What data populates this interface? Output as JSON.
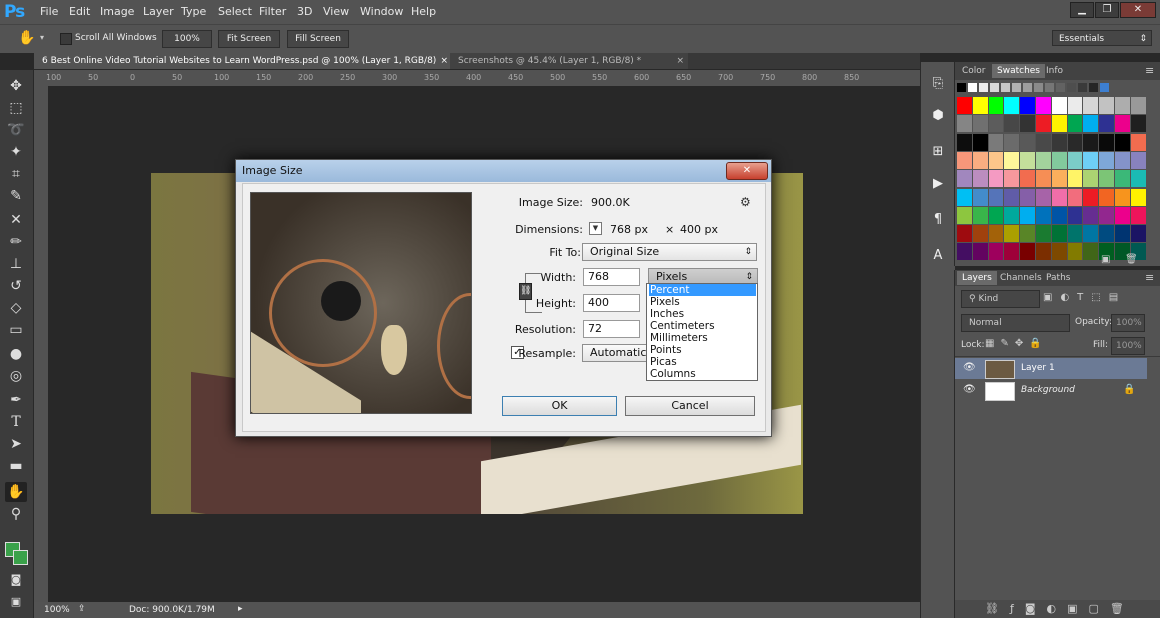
{
  "app": {
    "logo": "Ps"
  },
  "menu": [
    "File",
    "Edit",
    "Image",
    "Layer",
    "Type",
    "Select",
    "Filter",
    "3D",
    "View",
    "Window",
    "Help"
  ],
  "window_buttons": [
    "▁",
    "❐",
    "✕"
  ],
  "options": {
    "scroll_all_label": "Scroll All Windows",
    "btn_100": "100%",
    "btn_fit": "Fit Screen",
    "btn_fill": "Fill Screen",
    "workspace": "Essentials"
  },
  "tabs": [
    {
      "label": "6 Best Online Video Tutorial Websites to Learn WordPress.psd @ 100% (Layer 1, RGB/8)",
      "close": "×"
    },
    {
      "label": "Screenshots @ 45.4% (Layer 1, RGB/8) *",
      "close": "×"
    }
  ],
  "ruler": [
    "100",
    "50",
    "0",
    "50",
    "100",
    "150",
    "200",
    "250",
    "300",
    "350",
    "400",
    "450",
    "500",
    "550",
    "600",
    "650",
    "700",
    "750",
    "800",
    "850"
  ],
  "status": {
    "zoom": "100%",
    "doc": "Doc: 900.0K/1.79M"
  },
  "dialog": {
    "title": "Image Size",
    "close": "✕",
    "image_size_label": "Image Size:",
    "image_size_value": "900.0K",
    "dimensions_label": "Dimensions:",
    "dimensions_w": "768 px",
    "dimensions_x": "×",
    "dimensions_h": "400 px",
    "fit_label": "Fit To:",
    "fit_value": "Original Size",
    "width_label": "Width:",
    "width_value": "768",
    "height_label": "Height:",
    "height_value": "400",
    "resolution_label": "Resolution:",
    "resolution_value": "72",
    "resample_label": "Resample:",
    "resample_value": "Automatic",
    "unit_value": "Pixels",
    "unit_options": [
      "Percent",
      "Pixels",
      "Inches",
      "Centimeters",
      "Millimeters",
      "Points",
      "Picas",
      "Columns"
    ],
    "unit_highlighted": "Percent",
    "ok": "OK",
    "cancel": "Cancel"
  },
  "swatch_tabs": [
    "Color",
    "Swatches",
    "Info"
  ],
  "swatch_colors": [
    [
      "#000000",
      "#ffffff",
      "#ededed",
      "#d9d9d9",
      "#c6c6c6",
      "#b2b2b2",
      "#9e9e9e",
      "#8a8a8a",
      "#767676",
      "#626262",
      "#4e4e4e",
      "#3a3a3a",
      "#262626",
      "#3d7fd1"
    ],
    [
      "#ff0000",
      "#ffff00",
      "#00ff00",
      "#00ffff",
      "#0000ff",
      "#ff00ff",
      "#ffffff",
      "#ebebeb",
      "#d6d6d6",
      "#c2c2c2",
      "#adadad",
      "#999999"
    ],
    [
      "#858585",
      "#707070",
      "#5c5c5c",
      "#474747",
      "#333333",
      "#ed1c24",
      "#fff200",
      "#00a651",
      "#00aeef",
      "#2e3192",
      "#ec008c",
      "#1f1f1f"
    ],
    [
      "#0d0d0d",
      "#000000",
      "#7a7a7a",
      "#6b6b6b",
      "#595959",
      "#494949",
      "#383838",
      "#292929",
      "#1a1a1a",
      "#0a0a0a",
      "#000000",
      "#f26c4f"
    ],
    [
      "#f7977a",
      "#f9ad81",
      "#fdc68a",
      "#fff79a",
      "#c4df9b",
      "#a3d39c",
      "#82ca9d",
      "#7bcdc8",
      "#6ecff6",
      "#7ea7d8",
      "#8493ca",
      "#8882be"
    ],
    [
      "#a187be",
      "#bc8dbf",
      "#f49ac2",
      "#f6989d",
      "#f26c4f",
      "#f68e55",
      "#fbaf5c",
      "#fff467",
      "#acd372",
      "#7cc576",
      "#3bb878",
      "#1abbb4"
    ],
    [
      "#00bff3",
      "#438ccb",
      "#5574b9",
      "#605ca8",
      "#855fa8",
      "#a763a8",
      "#f06ea9",
      "#f26d7d",
      "#ed1c24",
      "#f26522",
      "#f7941d",
      "#fff200"
    ],
    [
      "#8dc63f",
      "#39b54a",
      "#00a651",
      "#00a99d",
      "#00aeef",
      "#0072bc",
      "#0054a6",
      "#2e3192",
      "#662d91",
      "#92278f",
      "#ec008c",
      "#ed145b"
    ],
    [
      "#9e0b0f",
      "#a0410d",
      "#a36209",
      "#aba000",
      "#598527",
      "#1a7b30",
      "#007236",
      "#00746b",
      "#0076a3",
      "#004b80",
      "#003471",
      "#1b1464"
    ],
    [
      "#440e62",
      "#630460",
      "#9e005d",
      "#9e0039",
      "#790000",
      "#7b2e00",
      "#7d4900",
      "#827b00",
      "#406618",
      "#005e20",
      "#005826",
      "#005952"
    ]
  ],
  "layers": {
    "tabs": [
      "Layers",
      "Channels",
      "Paths"
    ],
    "kind": "Kind",
    "blend": "Normal",
    "opacity_label": "Opacity:",
    "opacity_value": "100%",
    "lock_label": "Lock:",
    "fill_label": "Fill:",
    "fill_value": "100%",
    "items": [
      {
        "name": "Layer 1",
        "selected": true
      },
      {
        "name": "Background",
        "selected": false
      }
    ]
  }
}
